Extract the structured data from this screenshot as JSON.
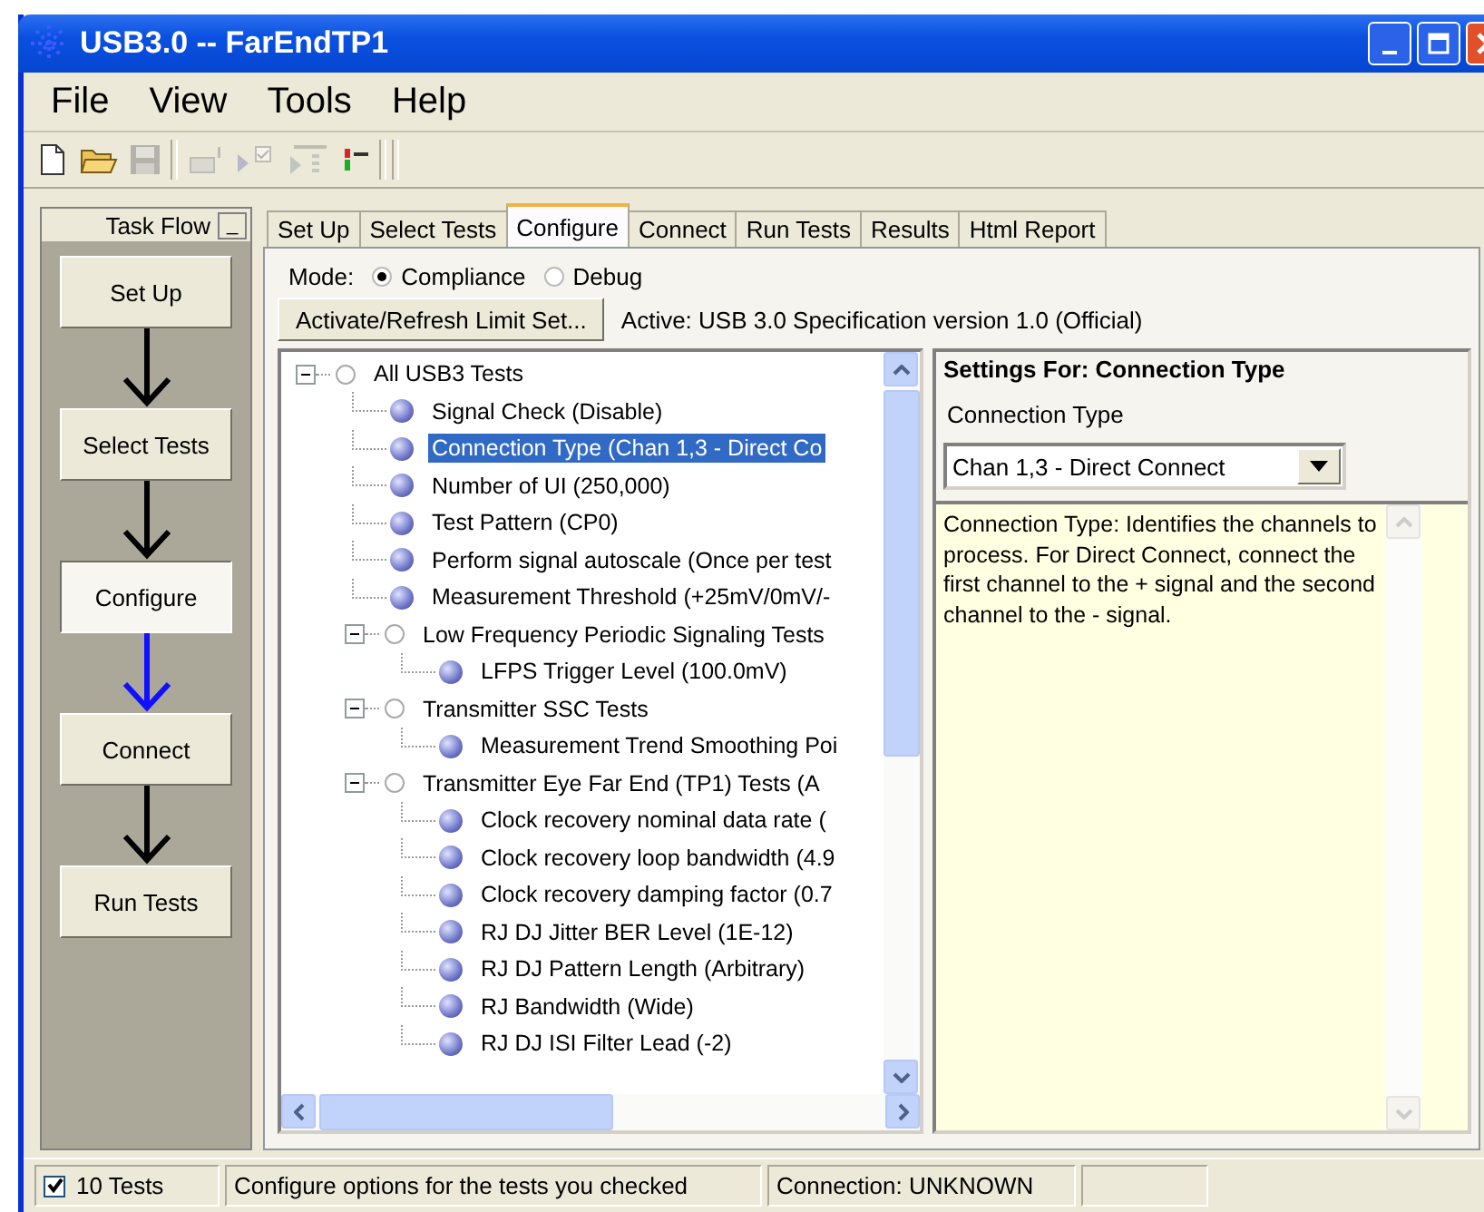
{
  "window": {
    "title": "USB3.0 -- FarEndTP1"
  },
  "menu": [
    "File",
    "View",
    "Tools",
    "Help"
  ],
  "toolbar": [
    {
      "kind": "new",
      "disabled": false
    },
    {
      "kind": "open",
      "disabled": false
    },
    {
      "kind": "save",
      "disabled": true
    },
    {
      "kind": "sep"
    },
    {
      "kind": "chart",
      "disabled": true
    },
    {
      "kind": "check",
      "disabled": true
    },
    {
      "kind": "list",
      "disabled": true
    },
    {
      "kind": "bars",
      "disabled": false
    },
    {
      "kind": "sep"
    },
    {
      "kind": "sep"
    }
  ],
  "task_flow": {
    "title": "Task Flow",
    "minimize": "_",
    "steps": [
      {
        "label": "Set Up",
        "selected": false
      },
      {
        "label": "Select Tests",
        "selected": false
      },
      {
        "label": "Configure",
        "selected": true
      },
      {
        "label": "Connect",
        "selected": false
      },
      {
        "label": "Run Tests",
        "selected": false
      }
    ]
  },
  "tabs": [
    {
      "label": "Set Up",
      "selected": false
    },
    {
      "label": "Select Tests",
      "selected": false
    },
    {
      "label": "Configure",
      "selected": true
    },
    {
      "label": "Connect",
      "selected": false
    },
    {
      "label": "Run Tests",
      "selected": false
    },
    {
      "label": "Results",
      "selected": false
    },
    {
      "label": "Html Report",
      "selected": false
    }
  ],
  "mode": {
    "label": "Mode:",
    "options": [
      {
        "label": "Compliance",
        "selected": true
      },
      {
        "label": "Debug",
        "selected": false
      }
    ]
  },
  "limit_set": {
    "button": "Activate/Refresh Limit Set...",
    "active": "Active:  USB 3.0 Specification version 1.0 (Official)"
  },
  "tree": [
    {
      "label": "All USB3 Tests",
      "kind": "group",
      "expanded": true,
      "selected": false,
      "children": [
        {
          "label": "Signal Check (Disable)",
          "kind": "leaf",
          "selected": false
        },
        {
          "label": "Connection Type (Chan 1,3 - Direct Co",
          "kind": "leaf",
          "selected": true
        },
        {
          "label": "Number of UI (250,000)",
          "kind": "leaf",
          "selected": false
        },
        {
          "label": "Test Pattern (CP0)",
          "kind": "leaf",
          "selected": false
        },
        {
          "label": "Perform signal autoscale (Once per test",
          "kind": "leaf",
          "selected": false
        },
        {
          "label": "Measurement Threshold (+25mV/0mV/-",
          "kind": "leaf",
          "selected": false
        },
        {
          "label": "Low Frequency Periodic Signaling Tests",
          "kind": "group",
          "expanded": true,
          "selected": false,
          "children": [
            {
              "label": "LFPS Trigger Level (100.0mV)",
              "kind": "leaf",
              "selected": false
            }
          ]
        },
        {
          "label": "Transmitter SSC Tests",
          "kind": "group",
          "expanded": true,
          "selected": false,
          "children": [
            {
              "label": "Measurement Trend Smoothing Poi",
              "kind": "leaf",
              "selected": false
            }
          ]
        },
        {
          "label": "Transmitter Eye Far End (TP1) Tests (A",
          "kind": "group",
          "expanded": true,
          "selected": false,
          "children": [
            {
              "label": "Clock recovery nominal data rate (",
              "kind": "leaf",
              "selected": false
            },
            {
              "label": "Clock recovery loop bandwidth (4.9",
              "kind": "leaf",
              "selected": false
            },
            {
              "label": "Clock recovery damping factor (0.7",
              "kind": "leaf",
              "selected": false
            },
            {
              "label": "RJ DJ Jitter BER Level (1E-12)",
              "kind": "leaf",
              "selected": false
            },
            {
              "label": "RJ DJ Pattern Length (Arbitrary)",
              "kind": "leaf",
              "selected": false
            },
            {
              "label": "RJ Bandwidth (Wide)",
              "kind": "leaf",
              "selected": false
            },
            {
              "label": "RJ DJ ISI Filter Lead (-2)",
              "kind": "leaf",
              "selected": false
            }
          ]
        }
      ]
    }
  ],
  "settings": {
    "title": "Settings For: Connection Type",
    "field_label": "Connection Type",
    "value": "Chan 1,3 - Direct Connect",
    "description": "Connection Type: Identifies the channels to process. For Direct Connect, connect the first channel to the + signal and the second channel to the - signal."
  },
  "status_bar": {
    "checked": true,
    "count": "10 Tests",
    "message": "Configure options for the tests you checked",
    "connection": "Connection: UNKNOWN"
  }
}
